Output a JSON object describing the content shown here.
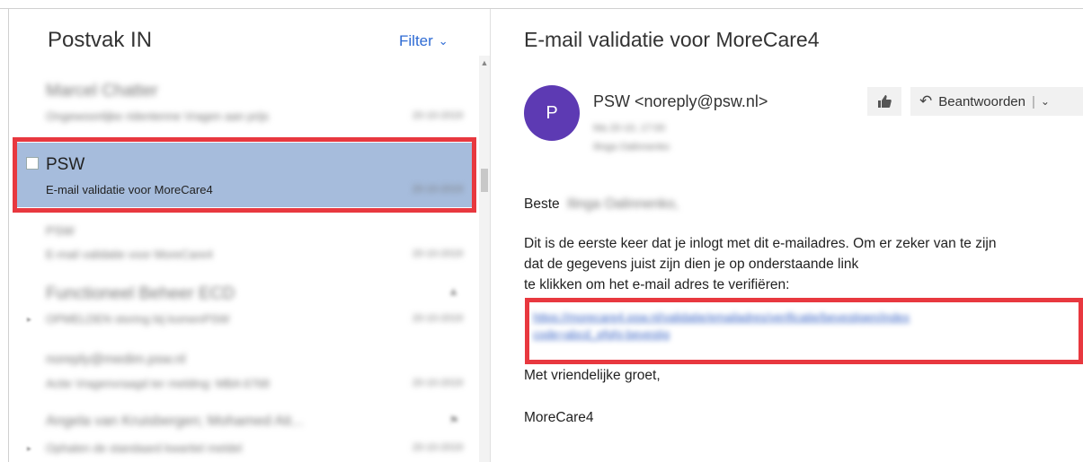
{
  "inbox": {
    "title": "Postvak IN",
    "filter_label": "Filter",
    "filter_icon": "chevron-down-icon",
    "messages": [
      {
        "sender": "Marcel Chatter",
        "subject": "Ongewoonlijke ridentenne Vragen aan prijs",
        "date": "20-10-2019",
        "blurred": true,
        "selected": false
      },
      {
        "sender": "PSW",
        "subject": "E-mail validatie voor MoreCare4",
        "date": "20-10-2019",
        "blurred": false,
        "selected": true
      },
      {
        "sender": "PSW",
        "subject": "E-mail validatie voor MoreCare4",
        "date": "20-10-2019",
        "blurred": true,
        "selected": false
      },
      {
        "sender": "Functioneel Beheer ECD",
        "subject": "OPMELDEN storing bij komenPSW",
        "date": "20-10-2019",
        "blurred": true,
        "selected": false
      },
      {
        "sender": "noreply@medim.psw.nl",
        "subject": "Actie Vragenvraagd ter melding: MBA 6768",
        "date": "20-10-2019",
        "blurred": true,
        "selected": false
      },
      {
        "sender": "Angela van Kruisbergen; Mohamed Ait...",
        "subject": "Ophalen de standaard kwartiel meldel",
        "date": "20-10-2019",
        "blurred": true,
        "selected": false
      }
    ]
  },
  "reader": {
    "subject": "E-mail validatie voor MoreCare4",
    "avatar_letter": "P",
    "avatar_color": "#5d3ab3",
    "from": "PSW <noreply@psw.nl>",
    "meta_date": "Ma 20-10, 17:00",
    "meta_to": "Ilinga Oalinnenko",
    "like_icon": "thumbs-up-icon",
    "reply_icon": "reply-arrow-icon",
    "reply_label": "Beantwoorden",
    "reply_separator": "|",
    "reply_dropdown_icon": "chevron-down-icon",
    "greeting": "Beste",
    "greeting_name": "Ilinga Oalinnenko,",
    "body_line1": "Dit is de eerste keer dat je inlogt met dit e-mailadres. Om er zeker van te zijn",
    "body_line2": "dat de gegevens juist zijn dien je op onderstaande link",
    "body_line3": "te klikken om het e-mail adres te verifiëren:",
    "link_line1": "https://morecare4.psw.nl/validatie/emailadres/verificatie/bevestigen/index",
    "link_line2": "code=abcd_efghi-bevestig",
    "closing": "Met vriendelijke groet,",
    "signature": "MoreCare4"
  },
  "colors": {
    "accent": "#2e6bd4",
    "selected_row": "#a6bcdc",
    "annotation_red": "#e8383f"
  }
}
